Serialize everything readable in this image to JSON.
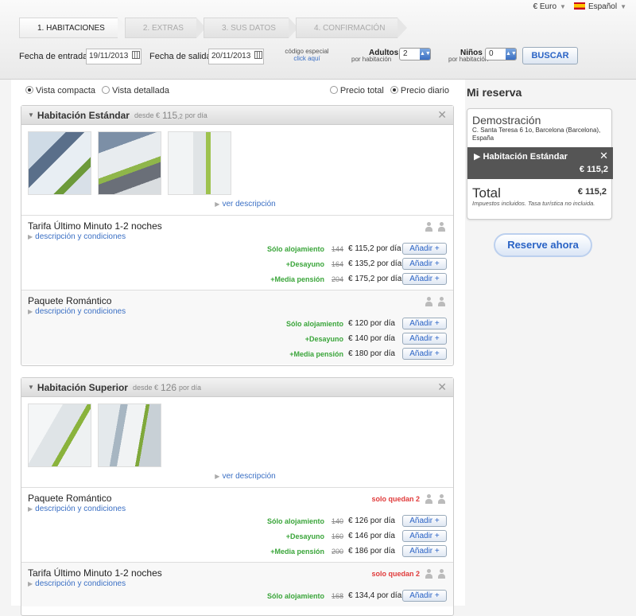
{
  "header": {
    "currency": "€ Euro",
    "language": "Español"
  },
  "steps": [
    "1. HABITACIONES",
    "2. EXTRAS",
    "3. SUS DATOS",
    "4. CONFIRMACIÓN"
  ],
  "search": {
    "checkin_label": "Fecha de entrada",
    "checkin": "19/11/2013",
    "checkout_label": "Fecha de salida",
    "checkout": "20/11/2013",
    "code_label": "código especial",
    "code_link": "click aquí",
    "adults_label": "Adultos",
    "adults_sub": "por habitación",
    "adults": "2",
    "children_label": "Niños",
    "children_sub": "por habitación",
    "children": "0",
    "search_btn": "BUSCAR"
  },
  "view": {
    "compact": "Vista compacta",
    "detailed": "Vista detallada",
    "total": "Precio total",
    "daily": "Precio diario"
  },
  "rooms": [
    {
      "name": "Habitación Estándar",
      "desde": "desde €",
      "price_main": "115",
      "price_dec": ",2",
      "por_dia": "por día",
      "ver": "ver descripción",
      "rates": [
        {
          "name": "Tarifa Último Minuto 1-2 noches",
          "cond": "descripción y condiciones",
          "solo": "",
          "options": [
            {
              "label": "Sólo alojamiento",
              "old": "144",
              "new": "€ 115,2 por día",
              "add": "Añadir +"
            },
            {
              "label": "+Desayuno",
              "old": "164",
              "new": "€ 135,2 por día",
              "add": "Añadir +"
            },
            {
              "label": "+Media pensión",
              "old": "204",
              "new": "€ 175,2 por día",
              "add": "Añadir +"
            }
          ]
        },
        {
          "name": "Paquete Romántico",
          "cond": "descripción y condiciones",
          "solo": "",
          "options": [
            {
              "label": "Sólo alojamiento",
              "old": "",
              "new": "€ 120 por día",
              "add": "Añadir +"
            },
            {
              "label": "+Desayuno",
              "old": "",
              "new": "€ 140 por día",
              "add": "Añadir +"
            },
            {
              "label": "+Media pensión",
              "old": "",
              "new": "€ 180 por día",
              "add": "Añadir +"
            }
          ]
        }
      ]
    },
    {
      "name": "Habitación Superior",
      "desde": "desde €",
      "price_main": "126",
      "price_dec": "",
      "por_dia": "por día",
      "ver": "ver descripción",
      "rates": [
        {
          "name": "Paquete Romántico",
          "cond": "descripción y condiciones",
          "solo": "solo quedan 2",
          "options": [
            {
              "label": "Sólo alojamiento",
              "old": "140",
              "new": "€ 126 por día",
              "add": "Añadir +"
            },
            {
              "label": "+Desayuno",
              "old": "160",
              "new": "€ 146 por día",
              "add": "Añadir +"
            },
            {
              "label": "+Media pensión",
              "old": "200",
              "new": "€ 186 por día",
              "add": "Añadir +"
            }
          ]
        },
        {
          "name": "Tarifa Último Minuto 1-2 noches",
          "cond": "descripción y condiciones",
          "solo": "solo quedan 2",
          "options": [
            {
              "label": "Sólo alojamiento",
              "old": "168",
              "new": "€ 134,4 por día",
              "add": "Añadir +"
            }
          ]
        }
      ]
    }
  ],
  "reserva": {
    "title": "Mi reserva",
    "hotel": "Demostración",
    "address": "C. Santa Teresa 6 1o, Barcelona (Barcelona), España",
    "selected": "Habitación Estándar",
    "selected_price": "€ 115,2",
    "total_label": "Total",
    "total": "€ 115,2",
    "tax": "Impuestos incluidos. Tasa turística no incluida.",
    "reserve_btn": "Reserve ahora"
  }
}
